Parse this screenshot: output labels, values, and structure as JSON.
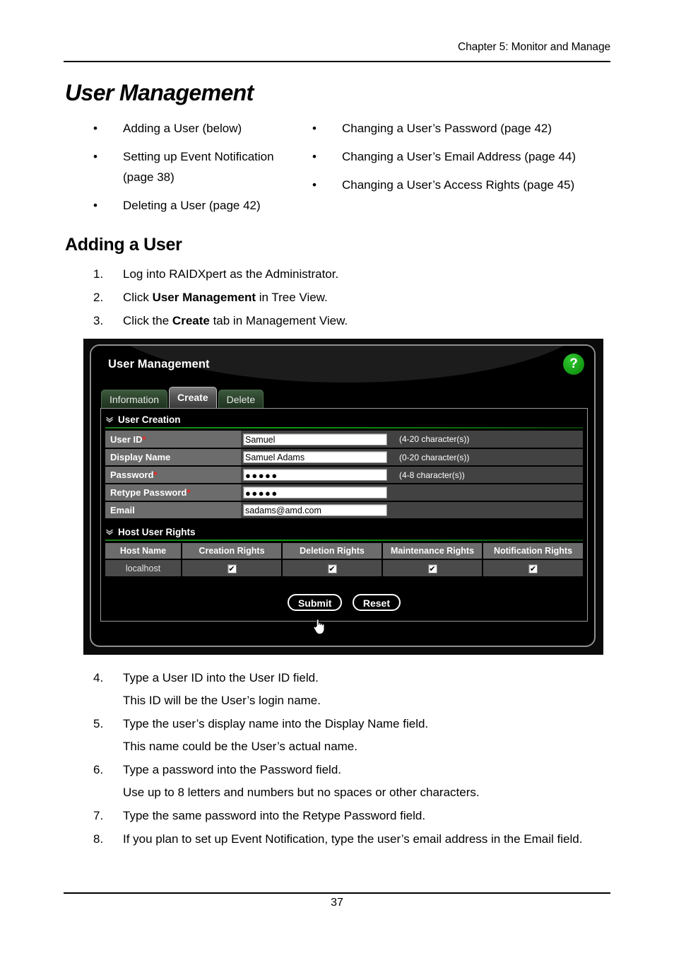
{
  "header": {
    "running_head": "Chapter 5: Monitor and Manage",
    "page_number": "37"
  },
  "title": "User Management",
  "bullets": {
    "left": [
      "Adding a User (below)",
      "Setting up Event Notification (page 38)",
      "Deleting a User (page 42)"
    ],
    "right": [
      "Changing a User’s Password (page 42)",
      "Changing a User’s Email Address (page 44)",
      "Changing a User’s Access Rights (page 45)"
    ],
    "marker": "•"
  },
  "section": {
    "heading": "Adding a User"
  },
  "steps_before": [
    {
      "num": "1.",
      "text": "Log into RAIDXpert as the Administrator."
    },
    {
      "num": "2.",
      "text_html": "Click <b>User Management</b> in Tree View."
    },
    {
      "num": "3.",
      "text_html": "Click the <b>Create</b> tab in Management View."
    }
  ],
  "steps_after": [
    {
      "num": "4.",
      "text": "Type a User ID into the User ID field.",
      "sub": "This ID will be the User’s login name."
    },
    {
      "num": "5.",
      "text": "Type the user’s display name into the Display Name field.",
      "sub": "This name could be the User’s actual name."
    },
    {
      "num": "6.",
      "text": "Type a password into the Password field.",
      "sub": "Use up to 8 letters and numbers but no spaces or other characters."
    },
    {
      "num": "7.",
      "text": "Type the same password into the Retype Password field."
    },
    {
      "num": "8.",
      "text": "If you plan to set up Event Notification, type the user’s email address in the Email field."
    }
  ],
  "screenshot": {
    "window_title": "User Management",
    "help_icon_label": "?",
    "accent_green": "#119911",
    "required_marker": "*",
    "tabs": [
      {
        "label": "Information",
        "active": false
      },
      {
        "label": "Create",
        "active": true
      },
      {
        "label": "Delete",
        "active": false
      }
    ],
    "user_creation": {
      "section_title": "User Creation",
      "chevron": "»",
      "fields": [
        {
          "label": "User ID",
          "required": true,
          "value": "Samuel",
          "hint": "(4-20 character(s))",
          "type": "text"
        },
        {
          "label": "Display Name",
          "required": false,
          "value": "Samuel Adams",
          "hint": "(0-20 character(s))",
          "type": "text"
        },
        {
          "label": "Password",
          "required": true,
          "value": "●●●●●",
          "hint": "(4-8 character(s))",
          "type": "password"
        },
        {
          "label": "Retype Password",
          "required": true,
          "value": "●●●●●",
          "hint": "",
          "type": "password"
        },
        {
          "label": "Email",
          "required": false,
          "value": "sadams@amd.com",
          "hint": "",
          "type": "text"
        }
      ]
    },
    "host_user_rights": {
      "section_title": "Host User Rights",
      "chevron": "»",
      "columns": [
        "Host Name",
        "Creation Rights",
        "Deletion Rights",
        "Maintenance Rights",
        "Notification Rights"
      ],
      "rows": [
        {
          "host": "localhost",
          "creation": true,
          "deletion": true,
          "maintenance": true,
          "notification": true
        }
      ],
      "checked_glyph": "✔"
    },
    "buttons": {
      "submit": "Submit",
      "reset": "Reset"
    }
  }
}
